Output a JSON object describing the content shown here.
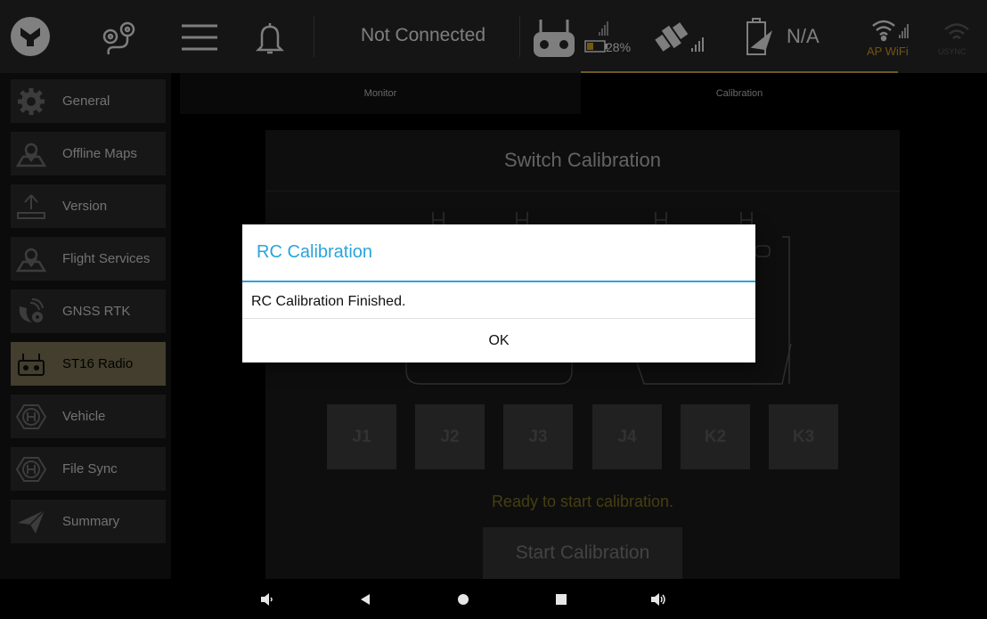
{
  "topbar": {
    "connection_status": "Not Connected",
    "rc_battery": "28%",
    "vehicle_battery": "N/A",
    "wifi_label": "AP WiFi",
    "usync_label": "USYNC"
  },
  "sidebar": {
    "items": [
      {
        "label": "General",
        "icon": "gear-icon"
      },
      {
        "label": "Offline Maps",
        "icon": "map-marker-icon"
      },
      {
        "label": "Version",
        "icon": "upload-icon"
      },
      {
        "label": "Flight Services",
        "icon": "map-marker-icon"
      },
      {
        "label": "GNSS RTK",
        "icon": "satellite-icon"
      },
      {
        "label": "ST16 Radio",
        "icon": "remote-controller-icon",
        "active": true
      },
      {
        "label": "Vehicle",
        "icon": "hexagon-h-icon"
      },
      {
        "label": "File Sync",
        "icon": "hexagon-h-icon"
      },
      {
        "label": "Summary",
        "icon": "paper-plane-icon"
      }
    ]
  },
  "tabs": {
    "monitor": "Monitor",
    "calibration": "Calibration"
  },
  "calibration": {
    "title": "Switch Calibration",
    "switches": [
      "J1",
      "J2",
      "J3",
      "J4",
      "K2",
      "K3"
    ],
    "status": "Ready to start calibration.",
    "start_button": "Start Calibration"
  },
  "dialog": {
    "title": "RC Calibration",
    "message": "RC Calibration Finished.",
    "ok": "OK"
  },
  "colors": {
    "accent": "#c9a53a",
    "dialog_title": "#2aa4da",
    "active_item": "#7a7252"
  }
}
